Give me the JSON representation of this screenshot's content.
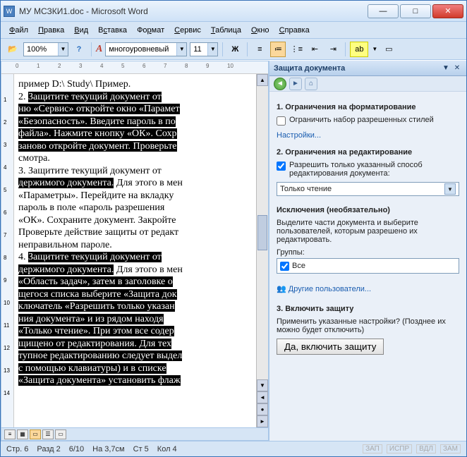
{
  "window_title": "МУ МСЗКИ1.doc - Microsoft Word",
  "menu": [
    "Файл",
    "Правка",
    "Вид",
    "Вставка",
    "Формат",
    "Сервис",
    "Таблица",
    "Окно",
    "Справка"
  ],
  "menu_underline": [
    0,
    0,
    0,
    1,
    2,
    0,
    0,
    0,
    0
  ],
  "toolbar": {
    "zoom": "100%",
    "style": "многоуровневый",
    "font_size": "11"
  },
  "pane": {
    "title": "Защита документа",
    "sect1": "1. Ограничения на форматирование",
    "chk1": "Ограничить набор разрешенных стилей",
    "link1": "Настройки...",
    "sect2": "2. Ограничения на редактирование",
    "chk2": "Разрешить только указанный способ редактирования документа:",
    "select_val": "Только чтение",
    "exc_title": "Исключения (необязательно)",
    "exc_desc": "Выделите части документа и выберите пользователей, которым разрешено их редактировать.",
    "groups_label": "Группы:",
    "group_item": "Все",
    "link2": "Другие пользователи...",
    "sect3": "3. Включить защиту",
    "apply_desc": "Применить указанные настройки? (Позднее их можно будет отключить)",
    "apply_btn": "Да, включить защиту"
  },
  "status": {
    "page": "Стр. 6",
    "sect": "Разд 2",
    "pages": "6/10",
    "at": "На 3,7см",
    "line": "Ст 5",
    "col": "Кол 4",
    "ind": [
      "ЗАП",
      "ИСПР",
      "ВДЛ",
      "ЗАМ"
    ]
  },
  "doc_lines": [
    {
      "type": "plain",
      "text": "пример D:\\ Study\\ Пример."
    },
    {
      "type": "mixed",
      "pre": "    2. ",
      "hl": "Защитите текущий документ от"
    },
    {
      "type": "hl",
      "text": "ню «Сервис» откройте окно «Парамет"
    },
    {
      "type": "hl",
      "text": "«Безопасность». Введите пароль в по"
    },
    {
      "type": "hl",
      "text": "файла». Нажмите кнопку «ОК». Сохр"
    },
    {
      "type": "hl",
      "text": "заново откройте документ. Проверьте"
    },
    {
      "type": "plain",
      "text": "смотра."
    },
    {
      "type": "plain",
      "text": "    3. Защитите текущий документ от"
    },
    {
      "type": "mixed",
      "pre": "",
      "hl": "держимого документа.",
      "post": " Для этого в мен"
    },
    {
      "type": "plain",
      "text": "«Параметры». Перейдите на вкладку"
    },
    {
      "type": "plain",
      "text": "пароль в поле «пароль разрешения"
    },
    {
      "type": "plain",
      "text": "«ОК». Сохраните документ. Закройте "
    },
    {
      "type": "plain",
      "text": "Проверьте действие защиты от редакт"
    },
    {
      "type": "plain",
      "text": "неправильном пароле."
    },
    {
      "type": "mixed",
      "pre": "    4. ",
      "hl": "Защитите текущий документ от"
    },
    {
      "type": "mixed",
      "pre": "",
      "hl": "держимого документа.",
      "post": " Для этого в мен"
    },
    {
      "type": "hl",
      "text": "«Область задач», затем в заголовке о"
    },
    {
      "type": "hl",
      "text": "щегося списка выберите «Защита док"
    },
    {
      "type": "hl",
      "text": "ключатель «Разрешить только указан"
    },
    {
      "type": "hl",
      "text": "ния документа» и из рядом находя"
    },
    {
      "type": "hl",
      "text": "«Только чтение». При этом все содер"
    },
    {
      "type": "hl",
      "text": "щищено от редактирования. Для тех"
    },
    {
      "type": "hl",
      "text": "тупное редактированию следует выдел"
    },
    {
      "type": "hl",
      "text": "с помощью клавиатуры) и в списке"
    },
    {
      "type": "hl",
      "text": "«Защита документа» установить флаж"
    }
  ]
}
